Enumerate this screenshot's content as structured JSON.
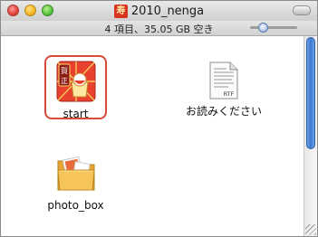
{
  "window": {
    "title": "2010_nenga",
    "title_icon_glyph": "寿",
    "status_text": "4 項目、35.05 GB 空き"
  },
  "items": [
    {
      "name": "start",
      "icon": "app-icon-nenga",
      "selected": true
    },
    {
      "name": "お読みください",
      "icon": "rtf-document-icon",
      "file_badge": "RTF",
      "selected": false
    },
    {
      "name": "photo_box",
      "icon": "folder-icon",
      "selected": false
    }
  ],
  "colors": {
    "selection": "#d94a3a",
    "scroll_accent": "#3c78d0",
    "folder": "#f2b544",
    "app_red": "#d8331f"
  }
}
